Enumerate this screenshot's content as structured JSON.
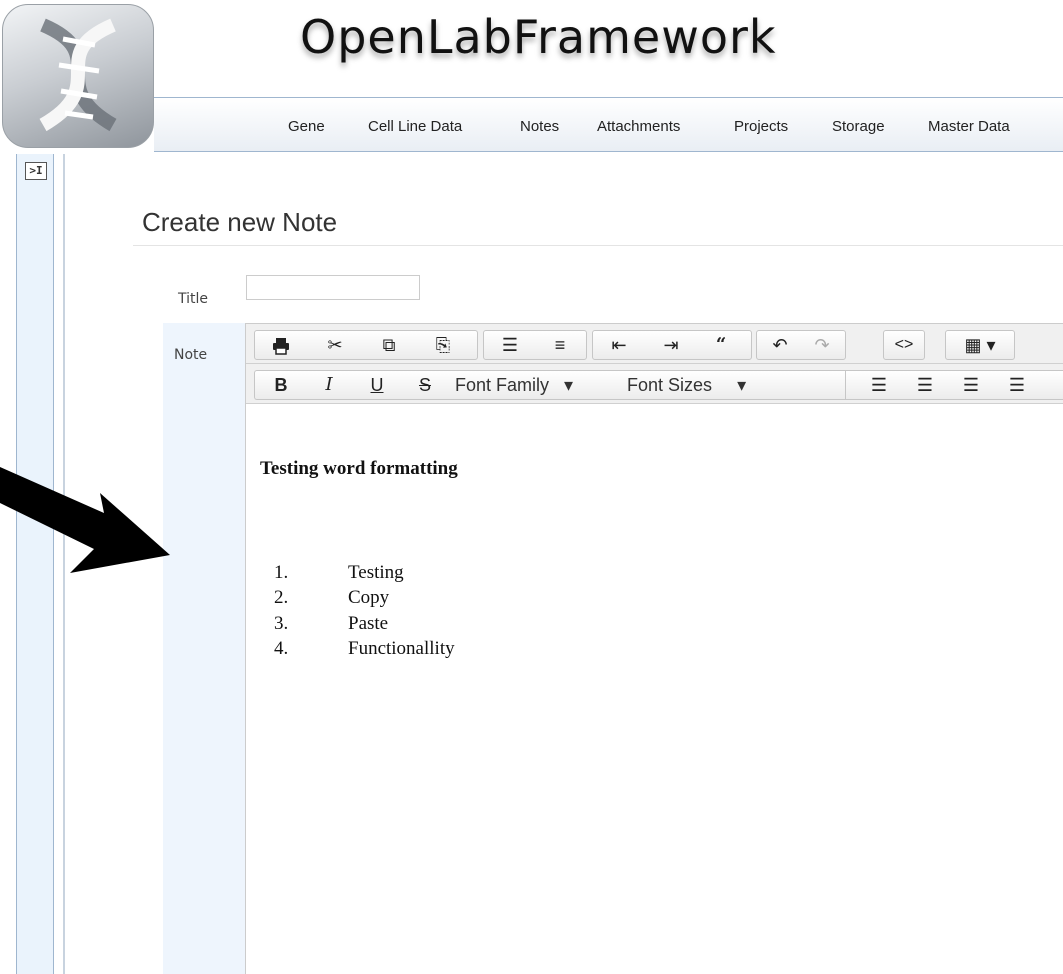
{
  "app": {
    "title": "OpenLabFramework"
  },
  "nav": {
    "items": [
      "Gene",
      "Cell Line Data",
      "Notes",
      "Attachments",
      "Projects",
      "Storage",
      "Master Data"
    ]
  },
  "rail": {
    "toggle_label": ">I"
  },
  "page": {
    "heading": "Create new Note"
  },
  "form": {
    "title_label": "Title",
    "title_value": "",
    "note_label": "Note"
  },
  "editor": {
    "toolbar_row1_icons": [
      "print-icon",
      "cut-icon",
      "copy-icon",
      "paste-icon",
      "bullet-list-icon",
      "numbered-list-icon",
      "outdent-icon",
      "indent-icon",
      "blockquote-icon",
      "undo-icon",
      "redo-icon",
      "code-icon",
      "table-icon"
    ],
    "bold_label": "B",
    "italic_label": "I",
    "underline_label": "U",
    "strike_label": "S",
    "font_family_label": "Font Family",
    "font_sizes_label": "Font Sizes",
    "heading_text": "Testing word formatting",
    "list": [
      {
        "num": "1.",
        "text": "Testing"
      },
      {
        "num": "2.",
        "text": "Copy"
      },
      {
        "num": "3.",
        "text": "Paste"
      },
      {
        "num": "4.",
        "text": "Functionallity"
      }
    ]
  },
  "colors": {
    "nav_border": "#9fb6cf",
    "rail_bg": "#eaf3fc",
    "note_bg": "#eef5fd"
  }
}
